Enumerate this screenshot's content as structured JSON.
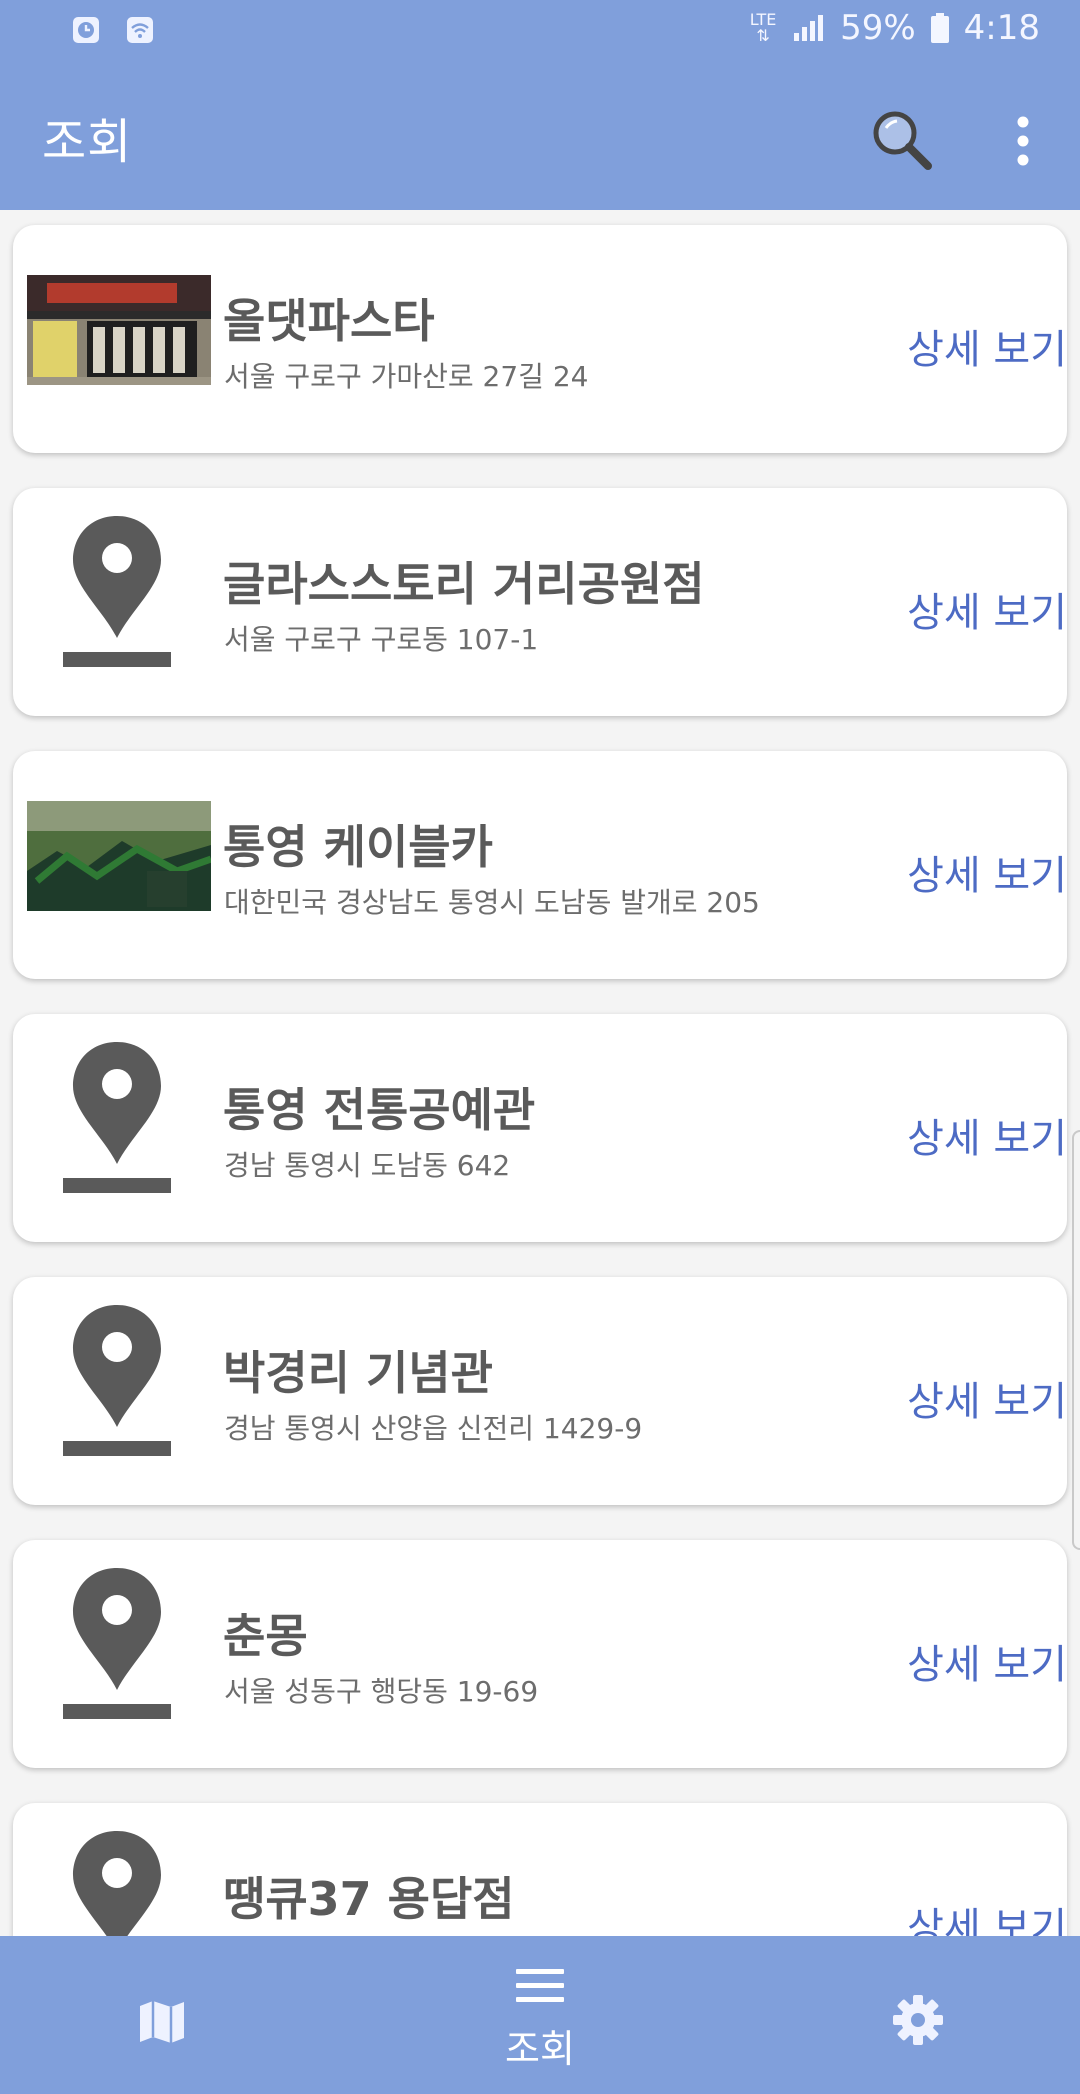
{
  "status_bar": {
    "network": "LTE",
    "battery": "59%",
    "time": "4:18",
    "icons": [
      "clock-icon",
      "wifi-icon",
      "signal-icon",
      "battery-icon"
    ]
  },
  "app_bar": {
    "title": "조회",
    "icons": [
      "search-icon",
      "more-vert-icon"
    ]
  },
  "places": [
    {
      "name": "올댓파스타",
      "address": "서울 구로구 가마산로 27길 24",
      "thumb": "photo",
      "link": "상세 보기"
    },
    {
      "name": "글라스스토리 거리공원점",
      "address": "서울 구로구 구로동 107-1",
      "thumb": "pin",
      "link": "상세 보기"
    },
    {
      "name": "통영 케이블카",
      "address": "대한민국 경상남도 통영시 도남동 발개로 205",
      "thumb": "photo",
      "link": "상세 보기"
    },
    {
      "name": "통영 전통공예관",
      "address": "경남 통영시 도남동 642",
      "thumb": "pin",
      "link": "상세 보기"
    },
    {
      "name": "박경리 기념관",
      "address": "경남 통영시 산양읍 신전리 1429-9",
      "thumb": "pin",
      "link": "상세 보기"
    },
    {
      "name": "춘몽",
      "address": "서울 성동구 행당동 19-69",
      "thumb": "pin",
      "link": "상세 보기"
    },
    {
      "name": "땡큐37 용답점",
      "address": "",
      "thumb": "pin",
      "link": "상세 보기"
    }
  ],
  "bottom_nav": {
    "items": [
      {
        "icon": "map-icon",
        "label": ""
      },
      {
        "icon": "menu-icon",
        "label": "조회"
      },
      {
        "icon": "settings-icon",
        "label": ""
      }
    ]
  },
  "colors": {
    "primary": "#809fdb",
    "link": "#4d6bc4",
    "pin": "#5a5a5a",
    "background": "#f4f4f4"
  }
}
